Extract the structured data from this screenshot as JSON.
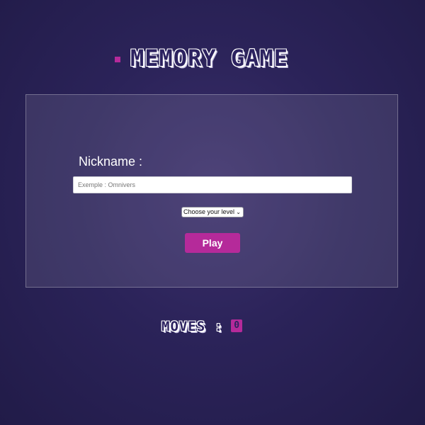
{
  "header": {
    "title": "MEMORY GAME"
  },
  "form": {
    "nickname_label": "Nickname :",
    "nickname_placeholder": "Exemple : Omnivers",
    "nickname_value": "",
    "level_selected": "Choose your level",
    "play_label": "Play"
  },
  "moves": {
    "label": "MOVES :",
    "count": "0"
  },
  "colors": {
    "accent": "#b52a9a",
    "background": "#2b2359"
  },
  "icons": {
    "level_chevron": "chevron-down-icon"
  }
}
